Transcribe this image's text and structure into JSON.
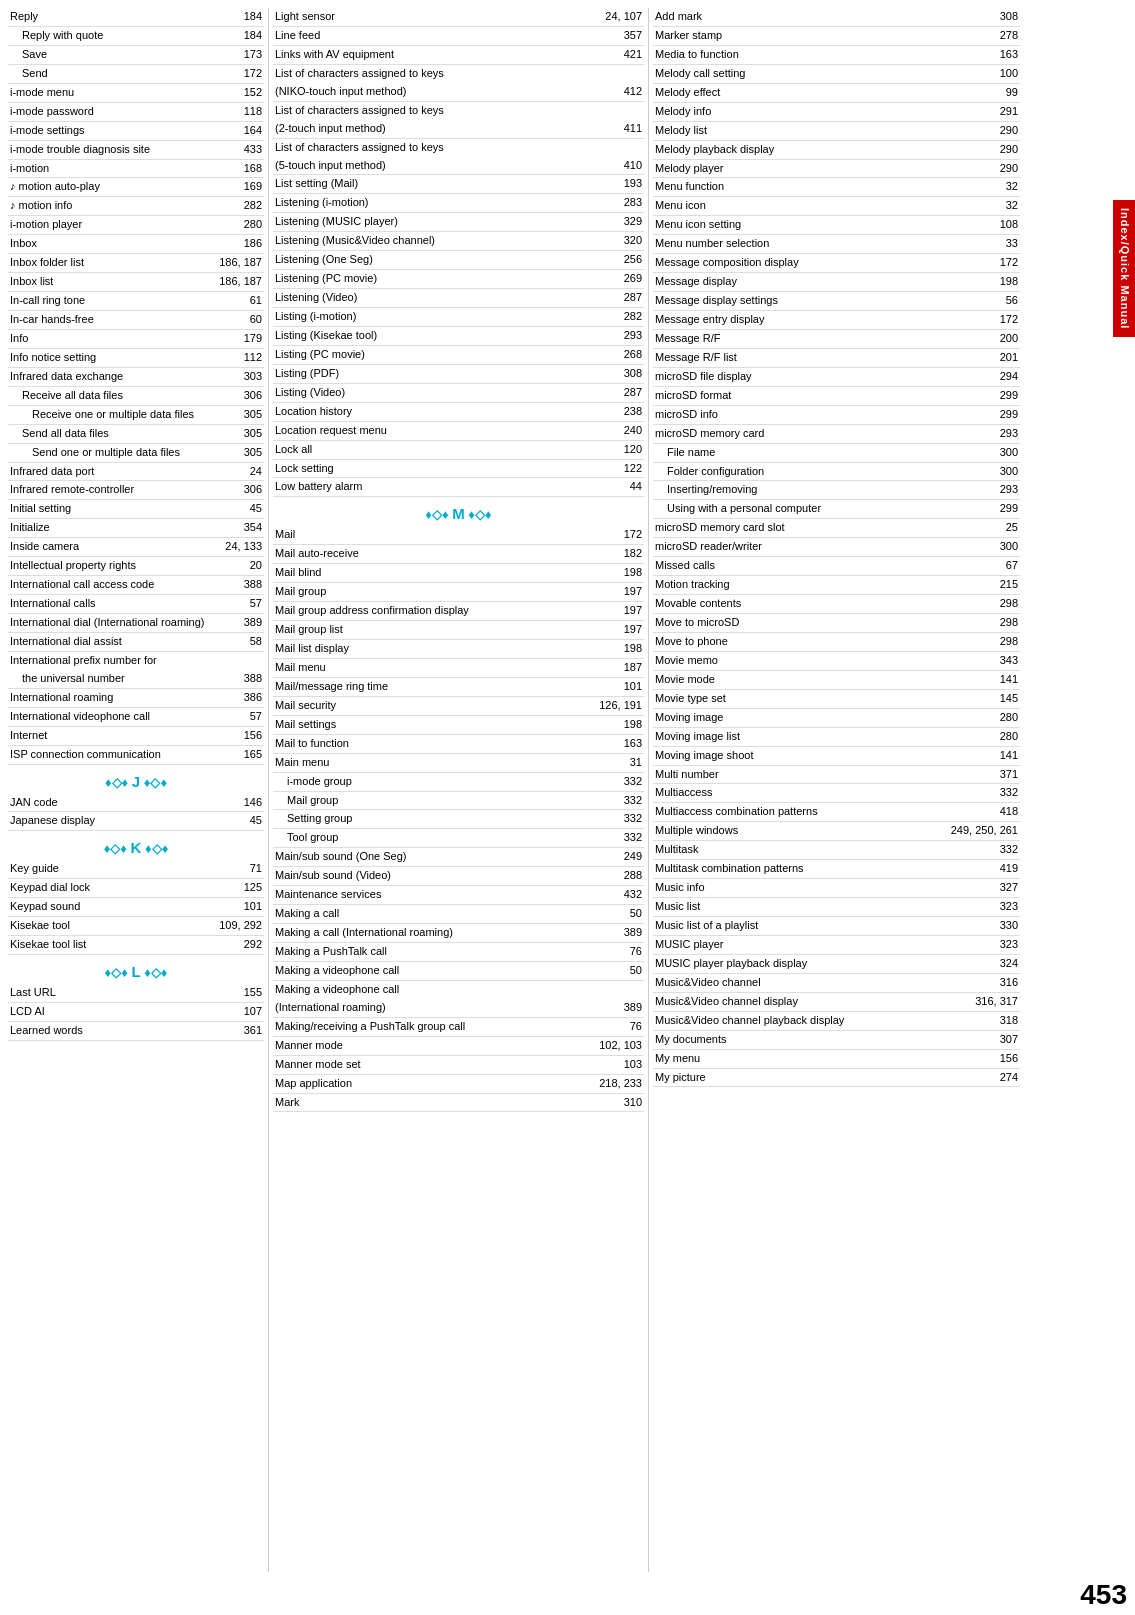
{
  "page": {
    "number": "453",
    "sidebar_label": "Index/Quick Manual"
  },
  "columns": [
    {
      "id": "col1",
      "entries": [
        {
          "label": "Reply",
          "page": "184",
          "indent": 0
        },
        {
          "label": "Reply with quote",
          "page": "184",
          "indent": 1
        },
        {
          "label": "Save",
          "page": "173",
          "indent": 1
        },
        {
          "label": "Send",
          "page": "172",
          "indent": 1
        },
        {
          "label": "i-mode menu",
          "page": "152",
          "indent": 0
        },
        {
          "label": "i-mode password",
          "page": "118",
          "indent": 0
        },
        {
          "label": "i-mode settings",
          "page": "164",
          "indent": 0
        },
        {
          "label": "i-mode trouble diagnosis site",
          "page": "433",
          "indent": 0
        },
        {
          "label": "i-motion",
          "page": "168",
          "indent": 0
        },
        {
          "label": "♪ motion auto-play",
          "page": "169",
          "indent": 0
        },
        {
          "label": "♪ motion info",
          "page": "282",
          "indent": 0
        },
        {
          "label": "i-motion player",
          "page": "280",
          "indent": 0
        },
        {
          "label": "Inbox",
          "page": "186",
          "indent": 0
        },
        {
          "label": "Inbox folder list",
          "page": "186, 187",
          "indent": 0
        },
        {
          "label": "Inbox list",
          "page": "186, 187",
          "indent": 0
        },
        {
          "label": "In-call ring tone",
          "page": "61",
          "indent": 0
        },
        {
          "label": "In-car hands-free",
          "page": "60",
          "indent": 0
        },
        {
          "label": "Info",
          "page": "179",
          "indent": 0
        },
        {
          "label": "Info notice setting",
          "page": "112",
          "indent": 0
        },
        {
          "label": "Infrared data exchange",
          "page": "303",
          "indent": 0
        },
        {
          "label": "Receive all data files",
          "page": "306",
          "indent": 1
        },
        {
          "label": "Receive one or multiple data files",
          "page": "305",
          "indent": 2
        },
        {
          "label": "Send all data files",
          "page": "305",
          "indent": 1
        },
        {
          "label": "Send one or multiple data files",
          "page": "305",
          "indent": 2
        },
        {
          "label": "Infrared data port",
          "page": "24",
          "indent": 0
        },
        {
          "label": "Infrared remote-controller",
          "page": "306",
          "indent": 0
        },
        {
          "label": "Initial setting",
          "page": "45",
          "indent": 0
        },
        {
          "label": "Initialize",
          "page": "354",
          "indent": 0
        },
        {
          "label": "Inside camera",
          "page": "24, 133",
          "indent": 0
        },
        {
          "label": "Intellectual property rights",
          "page": "20",
          "indent": 0
        },
        {
          "label": "International call access code",
          "page": "388",
          "indent": 0
        },
        {
          "label": "International calls",
          "page": "57",
          "indent": 0
        },
        {
          "label": "International dial (International roaming)",
          "page": "389",
          "indent": 0
        },
        {
          "label": "International dial assist",
          "page": "58",
          "indent": 0
        },
        {
          "label": "International prefix number for",
          "page": "",
          "indent": 0
        },
        {
          "label": "the universal number",
          "page": "388",
          "indent": 1
        },
        {
          "label": "International roaming",
          "page": "386",
          "indent": 0
        },
        {
          "label": "International videophone call",
          "page": "57",
          "indent": 0
        },
        {
          "label": "Internet",
          "page": "156",
          "indent": 0
        },
        {
          "label": "ISP connection communication",
          "page": "165",
          "indent": 0
        }
      ]
    },
    {
      "id": "col1b",
      "section": {
        "label": "J",
        "diamonds": "♦◇♦",
        "color": "#00aacc"
      },
      "after_section": [
        {
          "label": "JAN code",
          "page": "146",
          "indent": 0
        },
        {
          "label": "Japanese display",
          "page": "45",
          "indent": 0
        }
      ],
      "section2": {
        "label": "K",
        "diamonds": "♦◇♦",
        "color": "#00aacc"
      },
      "after_section2": [
        {
          "label": "Key guide",
          "page": "71",
          "indent": 0
        },
        {
          "label": "Keypad dial lock",
          "page": "125",
          "indent": 0
        },
        {
          "label": "Keypad sound",
          "page": "101",
          "indent": 0
        },
        {
          "label": "Kisekae tool",
          "page": "109, 292",
          "indent": 0
        },
        {
          "label": "Kisekae tool list",
          "page": "292",
          "indent": 0
        }
      ],
      "section3": {
        "label": "L",
        "diamonds": "♦◇♦",
        "color": "#00aacc"
      },
      "after_section3": [
        {
          "label": "Last URL",
          "page": "155",
          "indent": 0
        },
        {
          "label": "LCD AI",
          "page": "107",
          "indent": 0
        },
        {
          "label": "Learned words",
          "page": "361",
          "indent": 0
        }
      ]
    },
    {
      "id": "col2",
      "entries": [
        {
          "label": "Light sensor",
          "page": "24, 107",
          "indent": 0
        },
        {
          "label": "Line feed",
          "page": "357",
          "indent": 0
        },
        {
          "label": "Links with AV equipment",
          "page": "421",
          "indent": 0
        },
        {
          "label": "List of characters assigned to keys",
          "page": "",
          "indent": 0
        },
        {
          "label": "(NIKO-touch input method)",
          "page": "412",
          "indent": 0
        },
        {
          "label": "List of characters assigned to keys",
          "page": "",
          "indent": 0
        },
        {
          "label": "(2-touch input method)",
          "page": "411",
          "indent": 0
        },
        {
          "label": "List of characters assigned to keys",
          "page": "",
          "indent": 0
        },
        {
          "label": "(5-touch input method)",
          "page": "410",
          "indent": 0
        },
        {
          "label": "List setting (Mail)",
          "page": "193",
          "indent": 0
        },
        {
          "label": "Listening (i-motion)",
          "page": "283",
          "indent": 0
        },
        {
          "label": "Listening (MUSIC player)",
          "page": "329",
          "indent": 0
        },
        {
          "label": "Listening (Music&Video channel)",
          "page": "320",
          "indent": 0
        },
        {
          "label": "Listening (One Seg)",
          "page": "256",
          "indent": 0
        },
        {
          "label": "Listening (PC movie)",
          "page": "269",
          "indent": 0
        },
        {
          "label": "Listening (Video)",
          "page": "287",
          "indent": 0
        },
        {
          "label": "Listing (i-motion)",
          "page": "282",
          "indent": 0
        },
        {
          "label": "Listing (Kisekae tool)",
          "page": "293",
          "indent": 0
        },
        {
          "label": "Listing (PC movie)",
          "page": "268",
          "indent": 0
        },
        {
          "label": "Listing (PDF)",
          "page": "308",
          "indent": 0
        },
        {
          "label": "Listing (Video)",
          "page": "287",
          "indent": 0
        },
        {
          "label": "Location history",
          "page": "238",
          "indent": 0
        },
        {
          "label": "Location request menu",
          "page": "240",
          "indent": 0
        },
        {
          "label": "Lock all",
          "page": "120",
          "indent": 0
        },
        {
          "label": "Lock setting",
          "page": "122",
          "indent": 0
        },
        {
          "label": "Low battery alarm",
          "page": "44",
          "indent": 0
        }
      ],
      "section": {
        "label": "M",
        "diamonds": "♦◇♦",
        "color": "#00aacc"
      },
      "after_section": [
        {
          "label": "Mail",
          "page": "172",
          "indent": 0
        },
        {
          "label": "Mail auto-receive",
          "page": "182",
          "indent": 0
        },
        {
          "label": "Mail blind",
          "page": "198",
          "indent": 0
        },
        {
          "label": "Mail group",
          "page": "197",
          "indent": 0
        },
        {
          "label": "Mail group address confirmation display",
          "page": "197",
          "indent": 0
        },
        {
          "label": "Mail group list",
          "page": "197",
          "indent": 0
        },
        {
          "label": "Mail list display",
          "page": "198",
          "indent": 0
        },
        {
          "label": "Mail menu",
          "page": "187",
          "indent": 0
        },
        {
          "label": "Mail/message ring time",
          "page": "101",
          "indent": 0
        },
        {
          "label": "Mail security",
          "page": "126, 191",
          "indent": 0
        },
        {
          "label": "Mail settings",
          "page": "198",
          "indent": 0
        },
        {
          "label": "Mail to function",
          "page": "163",
          "indent": 0
        },
        {
          "label": "Main menu",
          "page": "31",
          "indent": 0
        },
        {
          "label": "i-mode group",
          "page": "332",
          "indent": 1
        },
        {
          "label": "Mail group",
          "page": "332",
          "indent": 1
        },
        {
          "label": "Setting group",
          "page": "332",
          "indent": 1
        },
        {
          "label": "Tool group",
          "page": "332",
          "indent": 1
        },
        {
          "label": "Main/sub sound (One Seg)",
          "page": "249",
          "indent": 0
        },
        {
          "label": "Main/sub sound (Video)",
          "page": "288",
          "indent": 0
        },
        {
          "label": "Maintenance services",
          "page": "432",
          "indent": 0
        },
        {
          "label": "Making a call",
          "page": "50",
          "indent": 0
        },
        {
          "label": "Making a call (International roaming)",
          "page": "389",
          "indent": 0
        },
        {
          "label": "Making a PushTalk call",
          "page": "76",
          "indent": 0
        },
        {
          "label": "Making a videophone call",
          "page": "50",
          "indent": 0
        },
        {
          "label": "Making a videophone call",
          "page": "",
          "indent": 0
        },
        {
          "label": "(International roaming)",
          "page": "389",
          "indent": 0
        },
        {
          "label": "Making/receiving a PushTalk group call",
          "page": "76",
          "indent": 0
        },
        {
          "label": "Manner mode",
          "page": "102, 103",
          "indent": 0
        },
        {
          "label": "Manner mode set",
          "page": "103",
          "indent": 0
        },
        {
          "label": "Map application",
          "page": "218, 233",
          "indent": 0
        },
        {
          "label": "Mark",
          "page": "310",
          "indent": 0
        }
      ]
    },
    {
      "id": "col3",
      "entries": [
        {
          "label": "Add mark",
          "page": "308",
          "indent": 0
        },
        {
          "label": "Marker stamp",
          "page": "278",
          "indent": 0
        },
        {
          "label": "Media to function",
          "page": "163",
          "indent": 0
        },
        {
          "label": "Melody call setting",
          "page": "100",
          "indent": 0
        },
        {
          "label": "Melody effect",
          "page": "99",
          "indent": 0
        },
        {
          "label": "Melody info",
          "page": "291",
          "indent": 0
        },
        {
          "label": "Melody list",
          "page": "290",
          "indent": 0
        },
        {
          "label": "Melody playback display",
          "page": "290",
          "indent": 0
        },
        {
          "label": "Melody player",
          "page": "290",
          "indent": 0
        },
        {
          "label": "Menu function",
          "page": "32",
          "indent": 0
        },
        {
          "label": "Menu icon",
          "page": "32",
          "indent": 0
        },
        {
          "label": "Menu icon setting",
          "page": "108",
          "indent": 0
        },
        {
          "label": "Menu number selection",
          "page": "33",
          "indent": 0
        },
        {
          "label": "Message composition display",
          "page": "172",
          "indent": 0
        },
        {
          "label": "Message display",
          "page": "198",
          "indent": 0
        },
        {
          "label": "Message display settings",
          "page": "56",
          "indent": 0
        },
        {
          "label": "Message entry display",
          "page": "172",
          "indent": 0
        },
        {
          "label": "Message R/F",
          "page": "200",
          "indent": 0
        },
        {
          "label": "Message R/F list",
          "page": "201",
          "indent": 0
        },
        {
          "label": "microSD file display",
          "page": "294",
          "indent": 0
        },
        {
          "label": "microSD format",
          "page": "299",
          "indent": 0
        },
        {
          "label": "microSD info",
          "page": "299",
          "indent": 0
        },
        {
          "label": "microSD memory card",
          "page": "293",
          "indent": 0
        },
        {
          "label": "File name",
          "page": "300",
          "indent": 1
        },
        {
          "label": "Folder configuration",
          "page": "300",
          "indent": 1
        },
        {
          "label": "Inserting/removing",
          "page": "293",
          "indent": 1
        },
        {
          "label": "Using with a personal computer",
          "page": "299",
          "indent": 1
        },
        {
          "label": "microSD memory card slot",
          "page": "25",
          "indent": 0
        },
        {
          "label": "microSD reader/writer",
          "page": "300",
          "indent": 0
        },
        {
          "label": "Missed calls",
          "page": "67",
          "indent": 0
        },
        {
          "label": "Motion tracking",
          "page": "215",
          "indent": 0
        },
        {
          "label": "Movable contents",
          "page": "298",
          "indent": 0
        },
        {
          "label": "Move to microSD",
          "page": "298",
          "indent": 0
        },
        {
          "label": "Move to phone",
          "page": "298",
          "indent": 0
        },
        {
          "label": "Movie memo",
          "page": "343",
          "indent": 0
        },
        {
          "label": "Movie mode",
          "page": "141",
          "indent": 0
        },
        {
          "label": "Movie type set",
          "page": "145",
          "indent": 0
        },
        {
          "label": "Moving image",
          "page": "280",
          "indent": 0
        },
        {
          "label": "Moving image list",
          "page": "280",
          "indent": 0
        },
        {
          "label": "Moving image shoot",
          "page": "141",
          "indent": 0
        },
        {
          "label": "Multi number",
          "page": "371",
          "indent": 0
        },
        {
          "label": "Multiaccess",
          "page": "332",
          "indent": 0
        },
        {
          "label": "Multiaccess combination patterns",
          "page": "418",
          "indent": 0
        },
        {
          "label": "Multiple windows",
          "page": "249, 250, 261",
          "indent": 0
        },
        {
          "label": "Multitask",
          "page": "332",
          "indent": 0
        },
        {
          "label": "Multitask combination patterns",
          "page": "419",
          "indent": 0
        },
        {
          "label": "Music info",
          "page": "327",
          "indent": 0
        },
        {
          "label": "Music list",
          "page": "323",
          "indent": 0
        },
        {
          "label": "Music list of a playlist",
          "page": "330",
          "indent": 0
        },
        {
          "label": "MUSIC player",
          "page": "323",
          "indent": 0
        },
        {
          "label": "MUSIC player playback display",
          "page": "324",
          "indent": 0
        },
        {
          "label": "Music&Video channel",
          "page": "316",
          "indent": 0
        },
        {
          "label": "Music&Video channel display",
          "page": "316, 317",
          "indent": 0
        },
        {
          "label": "Music&Video channel playback display",
          "page": "318",
          "indent": 0
        },
        {
          "label": "My documents",
          "page": "307",
          "indent": 0
        },
        {
          "label": "My menu",
          "page": "156",
          "indent": 0
        },
        {
          "label": "My picture",
          "page": "274",
          "indent": 0
        }
      ]
    }
  ]
}
